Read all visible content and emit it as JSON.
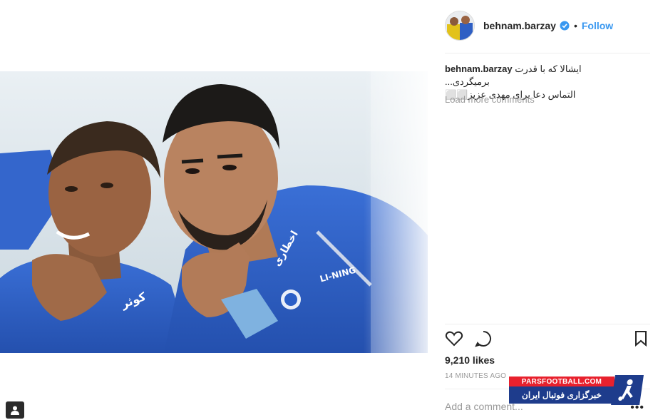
{
  "post": {
    "author": {
      "username": "behnam.barzay",
      "verified": true,
      "follow_label": "Follow",
      "separator": "•"
    },
    "caption": {
      "username": "behnam.barzay",
      "line1": "ایشالا که با قدرت برمیگردی...",
      "line2": "التماس دعا برای مهدی عزیز⬜⬜"
    },
    "load_more_label": "Load more comments",
    "actions": {
      "like_icon": "heart-icon",
      "comment_icon": "comment-icon",
      "save_icon": "bookmark-icon"
    },
    "likes_text": "9,210 likes",
    "timestamp": "14 MINUTES AGO",
    "add_comment_placeholder": "Add a comment...",
    "more_label": "•••"
  },
  "media": {
    "jersey_text_left": "کوثر",
    "jersey_text_right": "اخطاری",
    "brand_text": "LI-NING"
  },
  "watermark": {
    "site": "PARSFOOTBALL.COM",
    "title": "خبرگزاری فوتبال ایران"
  },
  "colors": {
    "accent": "#3897f0",
    "jersey": "#2f5fc4",
    "watermark_red": "#e8212d",
    "watermark_blue": "#1e3c8c"
  }
}
